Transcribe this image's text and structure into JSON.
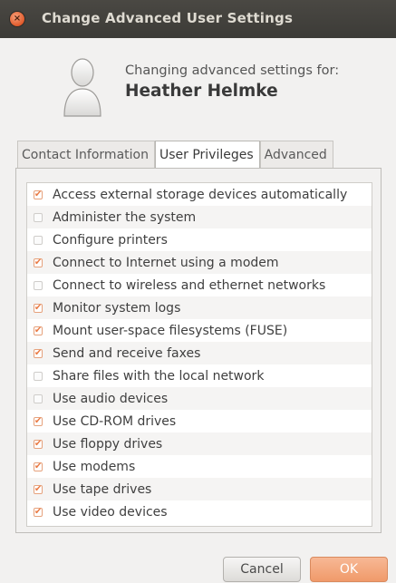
{
  "window": {
    "title": "Change Advanced User Settings",
    "close_glyph": "×"
  },
  "header": {
    "caption": "Changing advanced settings for:",
    "user_name": "Heather Helmke",
    "avatar_icon": "user-avatar-icon"
  },
  "tabs": [
    {
      "label": "Contact Information",
      "active": false
    },
    {
      "label": "User Privileges",
      "active": true
    },
    {
      "label": "Advanced",
      "active": false
    }
  ],
  "privileges": [
    {
      "label": "Access external storage devices automatically",
      "checked": true
    },
    {
      "label": "Administer the system",
      "checked": false
    },
    {
      "label": "Configure printers",
      "checked": false
    },
    {
      "label": "Connect to Internet using a modem",
      "checked": true
    },
    {
      "label": "Connect to wireless and ethernet networks",
      "checked": false
    },
    {
      "label": "Monitor system logs",
      "checked": true
    },
    {
      "label": "Mount user-space filesystems (FUSE)",
      "checked": true
    },
    {
      "label": "Send and receive faxes",
      "checked": true
    },
    {
      "label": "Share files with the local network",
      "checked": false
    },
    {
      "label": "Use audio devices",
      "checked": false
    },
    {
      "label": "Use CD-ROM drives",
      "checked": true
    },
    {
      "label": "Use floppy drives",
      "checked": true
    },
    {
      "label": "Use modems",
      "checked": true
    },
    {
      "label": "Use tape drives",
      "checked": true
    },
    {
      "label": "Use video devices",
      "checked": true
    }
  ],
  "buttons": {
    "cancel_label": "Cancel",
    "ok_label": "OK"
  },
  "colors": {
    "accent": "#f09a6a",
    "check": "#ea7b45",
    "titlebar": "#3c3b37"
  }
}
